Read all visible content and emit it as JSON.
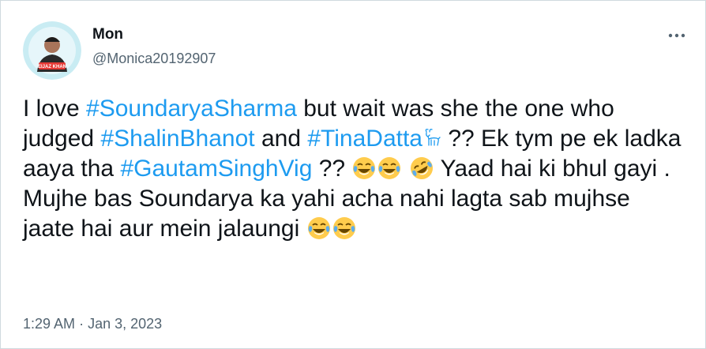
{
  "tweet": {
    "author": {
      "name": "Mon",
      "handle": "@Monica20192907",
      "avatar_caption": "EIJAZ KHAN"
    },
    "text": {
      "t1": "I love ",
      "tag1": "#SoundaryaSharma",
      "t2": " but wait was she the one who judged ",
      "tag2": "#ShalinBhanot",
      "t3": " and ",
      "tag3": "#TinaDatta",
      "t4": " ?? Ek tym pe ek ladka aaya tha ",
      "tag4": "#GautamSinghVig",
      "t5": " ?? ",
      "t6": " Yaad hai ki bhul gayi . Mujhe bas Soundarya ka yahi acha nahi lagta sab mujhse jaate hai aur mein jalaungi "
    },
    "time": "1:29 AM",
    "separator": "·",
    "date": "Jan 3, 2023"
  },
  "icons": {
    "more": "more-horizontal-icon",
    "goat": "goat-emoji",
    "joy": "face-with-tears-of-joy-emoji",
    "rofl": "rolling-on-floor-laughing-emoji"
  },
  "colors": {
    "link": "#1d9bf0",
    "secondary_text": "#536471",
    "primary_text": "#0f1419",
    "border": "#cfd9de"
  }
}
